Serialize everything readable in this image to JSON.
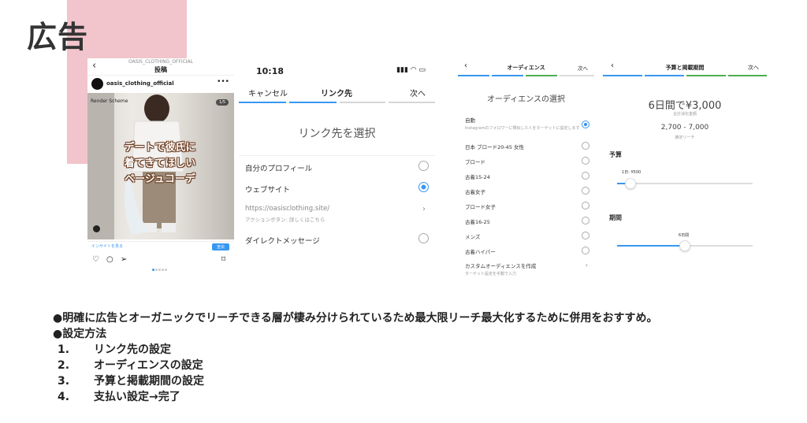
{
  "title": "広告",
  "panel1": {
    "account_header": "OASIS_CLOTHING_OFFICIAL",
    "post_label": "投稿",
    "username": "oasis_clothing_official",
    "scheme_text": "Render Scheme",
    "counter": "1/5",
    "caption_lines": [
      "デートで彼氏に",
      "着てきてほしい",
      "ベージュコーデ"
    ],
    "insight_link": "インサイトを見る",
    "promote_button": "宣伝"
  },
  "panel2": {
    "time": "10:18",
    "cancel": "キャンセル",
    "nav_title": "リンク先",
    "next": "次へ",
    "heading": "リンク先を選択",
    "options": [
      "自分のプロフィール",
      "ウェブサイト",
      "ダイレクトメッセージ"
    ],
    "selected_option": "ウェブサイト",
    "url": "https://oasisclothing.site/",
    "url_sub": "アクションボタン: 詳しくはこちら"
  },
  "panel3": {
    "nav_title": "オーディエンス",
    "next": "次へ",
    "heading": "オーディエンスの選択",
    "auto_label": "自動",
    "auto_sub": "Instagramのフォロワーに類似した人をターゲットに設定します",
    "options": [
      "日本 ブロード20-45 女性",
      "ブロード",
      "古着15-24",
      "古着女子",
      "ブロード女子",
      "古着16-25",
      "メンズ",
      "古着ハイパー"
    ],
    "custom_label": "カスタムオーディエンスを作成",
    "custom_sub": "ターゲット設定を手動で入力"
  },
  "panel4": {
    "nav_title": "予算と掲載期間",
    "next": "次へ",
    "total": "6日間で¥3,000",
    "total_sub": "合計消化金額",
    "reach": "2,700 - 7,000",
    "reach_sub": "推定リーチ",
    "budget_label": "予算",
    "budget_value": "1日: ¥500",
    "budget_fraction": 0.1,
    "period_label": "期間",
    "period_value": "6日間",
    "period_fraction": 0.5
  },
  "bullets": {
    "line1": "●明確に広告とオーガニックでリーチできる層が棲み分けられているため最大限リーチ最大化するために併用をおすすめ。",
    "line2": "●設定方法",
    "steps": [
      {
        "num": "1.",
        "text": "リンク先の設定"
      },
      {
        "num": "2.",
        "text": "オーディエンスの設定"
      },
      {
        "num": "3.",
        "text": "予算と掲載期間の設定"
      },
      {
        "num": "4.",
        "text": "支払い設定→完了"
      }
    ]
  },
  "colors": {
    "accent_blue": "#3897f0",
    "pink_block": "#f2c4cc",
    "caption_outline": "#6b3b1f"
  }
}
